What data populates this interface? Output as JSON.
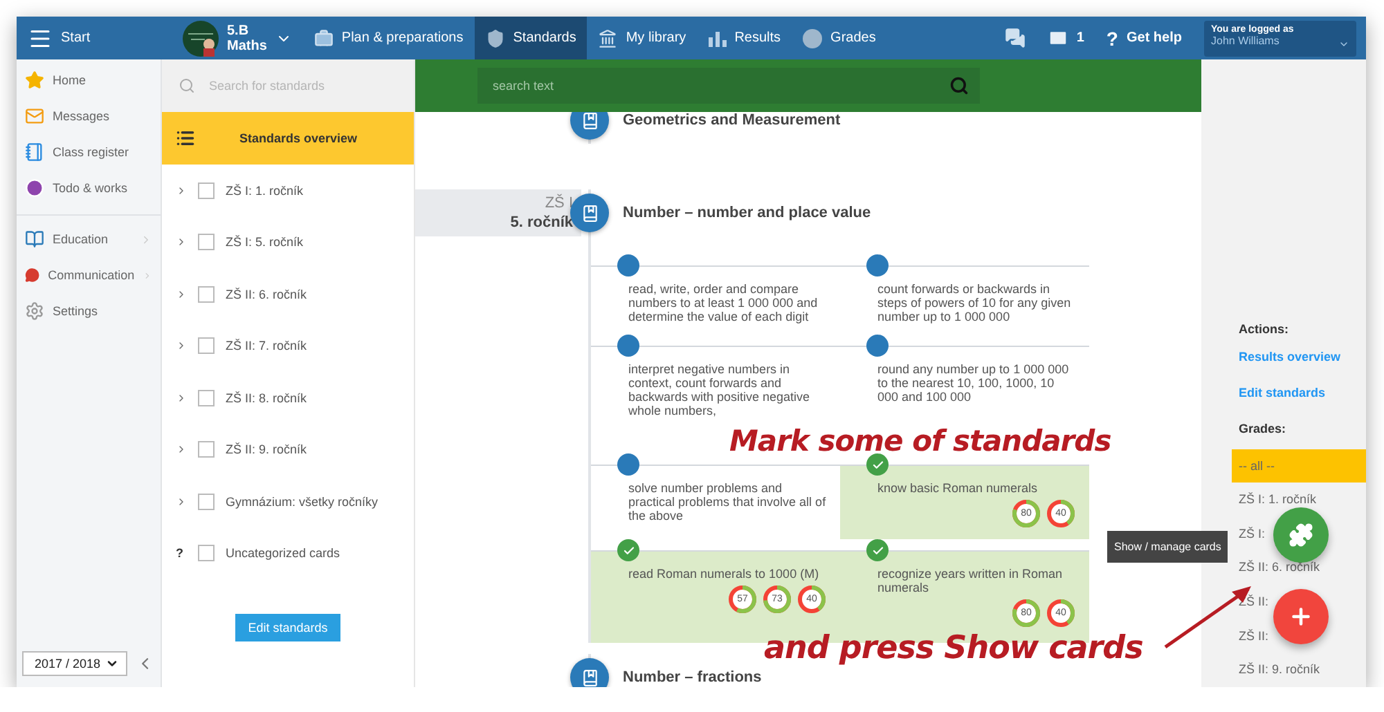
{
  "topbar": {
    "menu_label": "Start",
    "class": {
      "name": "5.B",
      "subject": "Maths"
    },
    "tabs": [
      {
        "label": "Plan & preparations",
        "selected": false
      },
      {
        "label": "Standards",
        "selected": true
      },
      {
        "label": "My library",
        "selected": false
      },
      {
        "label": "Results",
        "selected": false
      },
      {
        "label": "Grades",
        "selected": false
      }
    ],
    "messages_count": "1",
    "help_mark": "?",
    "help_label": "Get help",
    "user": {
      "caption": "You are logged as",
      "name": "John Williams"
    }
  },
  "sidebar": {
    "groups": [
      [
        {
          "label": "Home",
          "submenu": false
        },
        {
          "label": "Messages",
          "submenu": false
        },
        {
          "label": "Class register",
          "submenu": false
        },
        {
          "label": "Todo & works",
          "submenu": false
        }
      ],
      [
        {
          "label": "Education",
          "submenu": true
        },
        {
          "label": "Communication",
          "submenu": true
        },
        {
          "label": "Settings",
          "submenu": false
        }
      ]
    ],
    "year": "2017 / 2018"
  },
  "tree": {
    "search_placeholder": "Search for standards",
    "overview": {
      "label": "Standards overview",
      "selected": true
    },
    "items": [
      {
        "kind": "group",
        "label": "ZŠ I: 1. ročník",
        "checked": false
      },
      {
        "kind": "group",
        "label": "ZŠ I: 5. ročník",
        "checked": false
      },
      {
        "kind": "group",
        "label": "ZŠ II: 6. ročník",
        "checked": false
      },
      {
        "kind": "group",
        "label": "ZŠ II: 7. ročník",
        "checked": false
      },
      {
        "kind": "group",
        "label": "ZŠ II: 8. ročník",
        "checked": false
      },
      {
        "kind": "group",
        "label": "ZŠ II: 9. ročník",
        "checked": false
      },
      {
        "kind": "group",
        "label": "Gymnázium: všetky ročníky",
        "checked": false
      },
      {
        "kind": "other",
        "marker": "?",
        "label": "Uncategorized cards",
        "checked": false
      }
    ],
    "edit_button": "Edit standards"
  },
  "main": {
    "search_placeholder": "search text",
    "sections": [
      {
        "title": "Geometrics and Measurement"
      },
      {
        "grade": {
          "school": "ZŠ I",
          "year": "5. ročník"
        },
        "title": "Number – number and place value",
        "cards": [
          {
            "text": "read, write, order and compare numbers to at least 1 000 000 and determine the value of each digit",
            "checked": false
          },
          {
            "text": "count forwards or backwards in steps of powers of 10 for any given number up to 1 000 000",
            "checked": false
          },
          {
            "text": "interpret negative numbers in context, count forwards and backwards with positive negative whole numbers,",
            "checked": false
          },
          {
            "text": "round any number up to 1 000 000 to the nearest 10, 100, 1000, 10 000 and 100 000",
            "checked": false
          },
          {
            "text": "solve number problems and practical problems that involve all of the above",
            "checked": false
          },
          {
            "text": "know basic Roman numerals",
            "checked": true,
            "scores": [
              {
                "value": "80",
                "level": 0.8
              },
              {
                "value": "40",
                "level": 0.4
              }
            ]
          },
          {
            "text": "read Roman numerals to 1000 (M)",
            "checked": true,
            "scores": [
              {
                "value": "57",
                "level": 0.57
              },
              {
                "value": "73",
                "level": 0.73
              },
              {
                "value": "40",
                "level": 0.4
              }
            ]
          },
          {
            "text": "recognize years written in Roman numerals",
            "checked": true,
            "scores": [
              {
                "value": "80",
                "level": 0.8
              },
              {
                "value": "40",
                "level": 0.4
              }
            ]
          }
        ]
      },
      {
        "title": "Number – fractions"
      }
    ]
  },
  "right": {
    "actions_title": "Actions:",
    "actions": [
      "Results overview",
      "Edit standards"
    ],
    "grades_title": "Grades:",
    "grades": [
      {
        "label": "-- all --",
        "selected": true
      },
      {
        "label": "ZŠ I: 1. ročník",
        "selected": false
      },
      {
        "label": "ZŠ I:",
        "selected": false
      },
      {
        "label": "ZŠ II: 6. ročník",
        "selected": false
      },
      {
        "label": "ZŠ II:",
        "selected": false
      },
      {
        "label": "ZŠ II:",
        "selected": false
      },
      {
        "label": "ZŠ II: 9. ročník",
        "selected": false
      }
    ]
  },
  "fab": {
    "tooltip": "Show / manage cards"
  },
  "annotations": [
    "Mark some of standards",
    "and press Show cards"
  ]
}
